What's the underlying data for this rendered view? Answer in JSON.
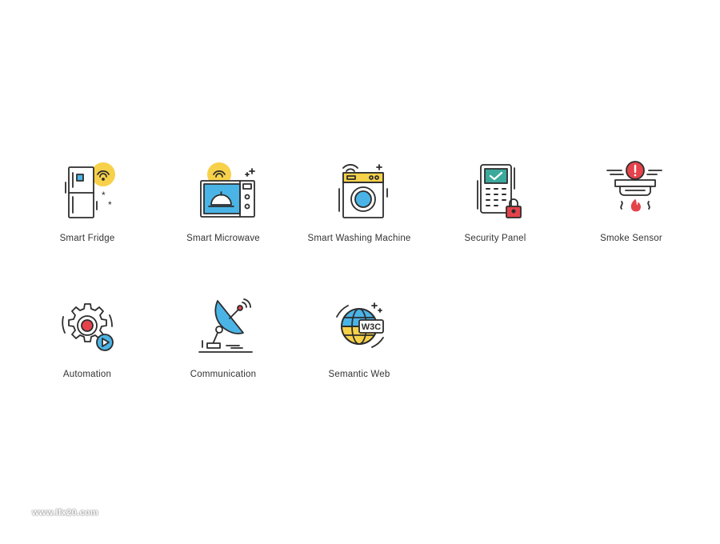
{
  "icons": [
    {
      "label": "Smart Fridge",
      "icon": "smart-fridge-icon"
    },
    {
      "label": "Smart Microwave",
      "icon": "smart-microwave-icon"
    },
    {
      "label": "Smart Washing Machine",
      "icon": "smart-washing-machine-icon"
    },
    {
      "label": "Security Panel",
      "icon": "security-panel-icon"
    },
    {
      "label": "Smoke Sensor",
      "icon": "smoke-sensor-icon"
    },
    {
      "label": "Automation",
      "icon": "automation-icon"
    },
    {
      "label": "Communication",
      "icon": "communication-icon"
    },
    {
      "label": "Semantic Web",
      "icon": "semantic-web-icon"
    }
  ],
  "watermark": "www.lfx20.com",
  "colors": {
    "yellow": "#F7D14A",
    "blue": "#4BB4E6",
    "red": "#E4434B",
    "teal": "#3BA99C",
    "stroke": "#2D2D2D"
  }
}
